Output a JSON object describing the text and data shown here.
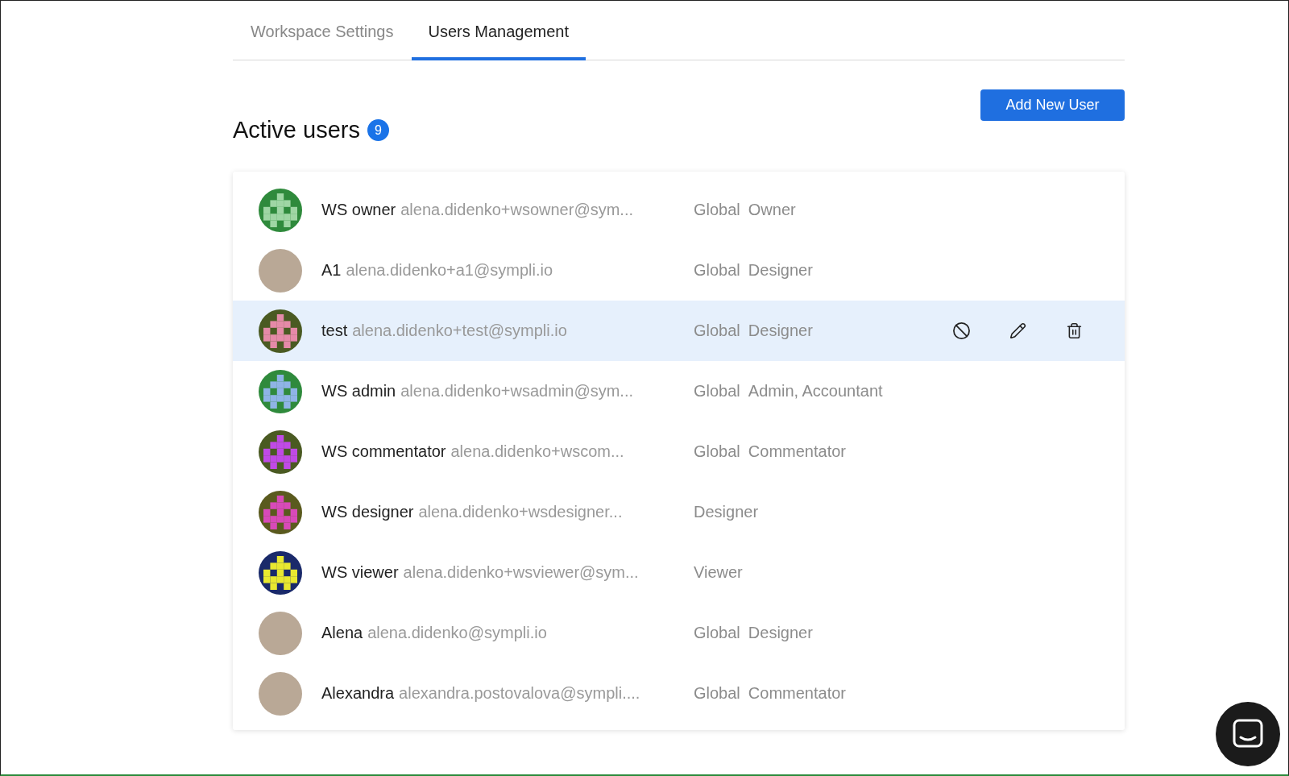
{
  "tabs": [
    {
      "label": "Workspace Settings",
      "selected": false
    },
    {
      "label": "Users Management",
      "selected": true
    }
  ],
  "add_button": "Add New User",
  "heading": {
    "title": "Active users",
    "count": "9"
  },
  "users": [
    {
      "name": "WS owner",
      "email": "alena.didenko+wsowner@sym...",
      "scope": "Global",
      "role": "Owner",
      "hovered": false,
      "avatar": {
        "kind": "identicon",
        "ground": {
          "color": "#2f8a3c"
        },
        "pattern": {
          "color": "#9fd6a4"
        }
      }
    },
    {
      "name": "A1",
      "email": "alena.didenko+a1@sympli.io",
      "scope": "Global",
      "role": "Designer",
      "hovered": false,
      "avatar": {
        "kind": "photo"
      }
    },
    {
      "name": "test",
      "email": "alena.didenko+test@sympli.io",
      "scope": "Global",
      "role": "Designer",
      "hovered": true,
      "avatar": {
        "kind": "identicon",
        "ground": {
          "color": "#4a5a22"
        },
        "pattern": {
          "color": "#e58aa8"
        }
      }
    },
    {
      "name": "WS admin",
      "email": "alena.didenko+wsadmin@sym...",
      "scope": "Global",
      "role": "Admin, Accountant",
      "hovered": false,
      "avatar": {
        "kind": "identicon",
        "ground": {
          "color": "#2f8a3c"
        },
        "pattern": {
          "color": "#8fb4e6"
        }
      }
    },
    {
      "name": "WS commentator",
      "email": "alena.didenko+wscom...",
      "scope": "Global",
      "role": "Commentator",
      "hovered": false,
      "avatar": {
        "kind": "identicon",
        "ground": {
          "color": "#4a5a22"
        },
        "pattern": {
          "color": "#c04ae6"
        }
      }
    },
    {
      "name": "WS designer",
      "email": "alena.didenko+wsdesigner...",
      "role": "Designer",
      "hovered": false,
      "avatar": {
        "kind": "identicon",
        "ground": {
          "color": "#5a5a1e"
        },
        "pattern": {
          "color": "#d84ab8"
        }
      }
    },
    {
      "name": "WS viewer",
      "email": "alena.didenko+wsviewer@sym...",
      "role": "Viewer",
      "hovered": false,
      "avatar": {
        "kind": "identicon",
        "ground": {
          "color": "#1a2a6a"
        },
        "pattern": {
          "color": "#e8e830"
        }
      }
    },
    {
      "name": "Alena",
      "email": "alena.didenko@sympli.io",
      "scope": "Global",
      "role": "Designer",
      "hovered": false,
      "avatar": {
        "kind": "photo"
      }
    },
    {
      "name": "Alexandra",
      "email": "alexandra.postovalova@sympli....",
      "scope": "Global",
      "role": "Commentator",
      "hovered": false,
      "avatar": {
        "kind": "photo"
      }
    }
  ]
}
